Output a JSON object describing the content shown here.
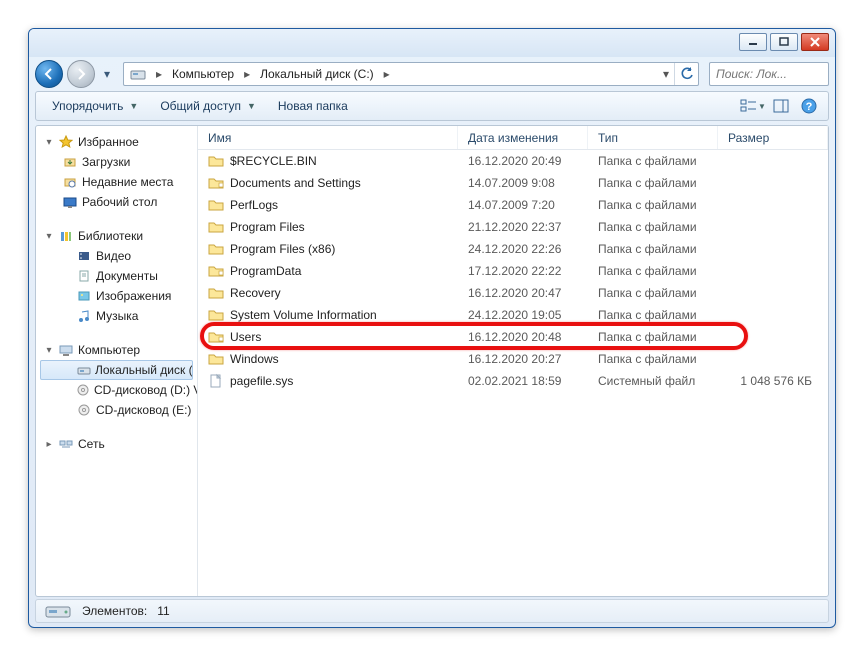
{
  "breadcrumb": {
    "items": [
      "Компьютер",
      "Локальный диск (C:)"
    ]
  },
  "search": {
    "placeholder": "Поиск: Лок..."
  },
  "toolbar": {
    "organize": "Упорядочить",
    "share": "Общий доступ",
    "new_folder": "Новая папка"
  },
  "sidebar": {
    "favorites": {
      "label": "Избранное",
      "items": [
        "Загрузки",
        "Недавние места",
        "Рабочий стол"
      ]
    },
    "libraries": {
      "label": "Библиотеки",
      "items": [
        "Видео",
        "Документы",
        "Изображения",
        "Музыка"
      ]
    },
    "computer": {
      "label": "Компьютер",
      "items": [
        "Локальный диск (C:)",
        "CD-дисковод (D:) Vi",
        "CD-дисковод (E:)"
      ]
    },
    "network": {
      "label": "Сеть"
    }
  },
  "columns": {
    "name": "Имя",
    "date": "Дата изменения",
    "type": "Тип",
    "size": "Размер"
  },
  "files": [
    {
      "name": "$RECYCLE.BIN",
      "date": "16.12.2020 20:49",
      "type": "Папка с файлами",
      "size": "",
      "icon": "folder"
    },
    {
      "name": "Documents and Settings",
      "date": "14.07.2009 9:08",
      "type": "Папка с файлами",
      "size": "",
      "icon": "folder-short"
    },
    {
      "name": "PerfLogs",
      "date": "14.07.2009 7:20",
      "type": "Папка с файлами",
      "size": "",
      "icon": "folder"
    },
    {
      "name": "Program Files",
      "date": "21.12.2020 22:37",
      "type": "Папка с файлами",
      "size": "",
      "icon": "folder"
    },
    {
      "name": "Program Files (x86)",
      "date": "24.12.2020 22:26",
      "type": "Папка с файлами",
      "size": "",
      "icon": "folder"
    },
    {
      "name": "ProgramData",
      "date": "17.12.2020 22:22",
      "type": "Папка с файлами",
      "size": "",
      "icon": "folder-short"
    },
    {
      "name": "Recovery",
      "date": "16.12.2020 20:47",
      "type": "Папка с файлами",
      "size": "",
      "icon": "folder"
    },
    {
      "name": "System Volume Information",
      "date": "24.12.2020 19:05",
      "type": "Папка с файлами",
      "size": "",
      "icon": "folder"
    },
    {
      "name": "Users",
      "date": "16.12.2020 20:48",
      "type": "Папка с файлами",
      "size": "",
      "icon": "folder-short"
    },
    {
      "name": "Windows",
      "date": "16.12.2020 20:27",
      "type": "Папка с файлами",
      "size": "",
      "icon": "folder"
    },
    {
      "name": "pagefile.sys",
      "date": "02.02.2021 18:59",
      "type": "Системный файл",
      "size": "1 048 576 КБ",
      "icon": "file"
    }
  ],
  "highlight_row_index": 8,
  "status": {
    "elements_label": "Элементов:",
    "elements_count": "11"
  }
}
